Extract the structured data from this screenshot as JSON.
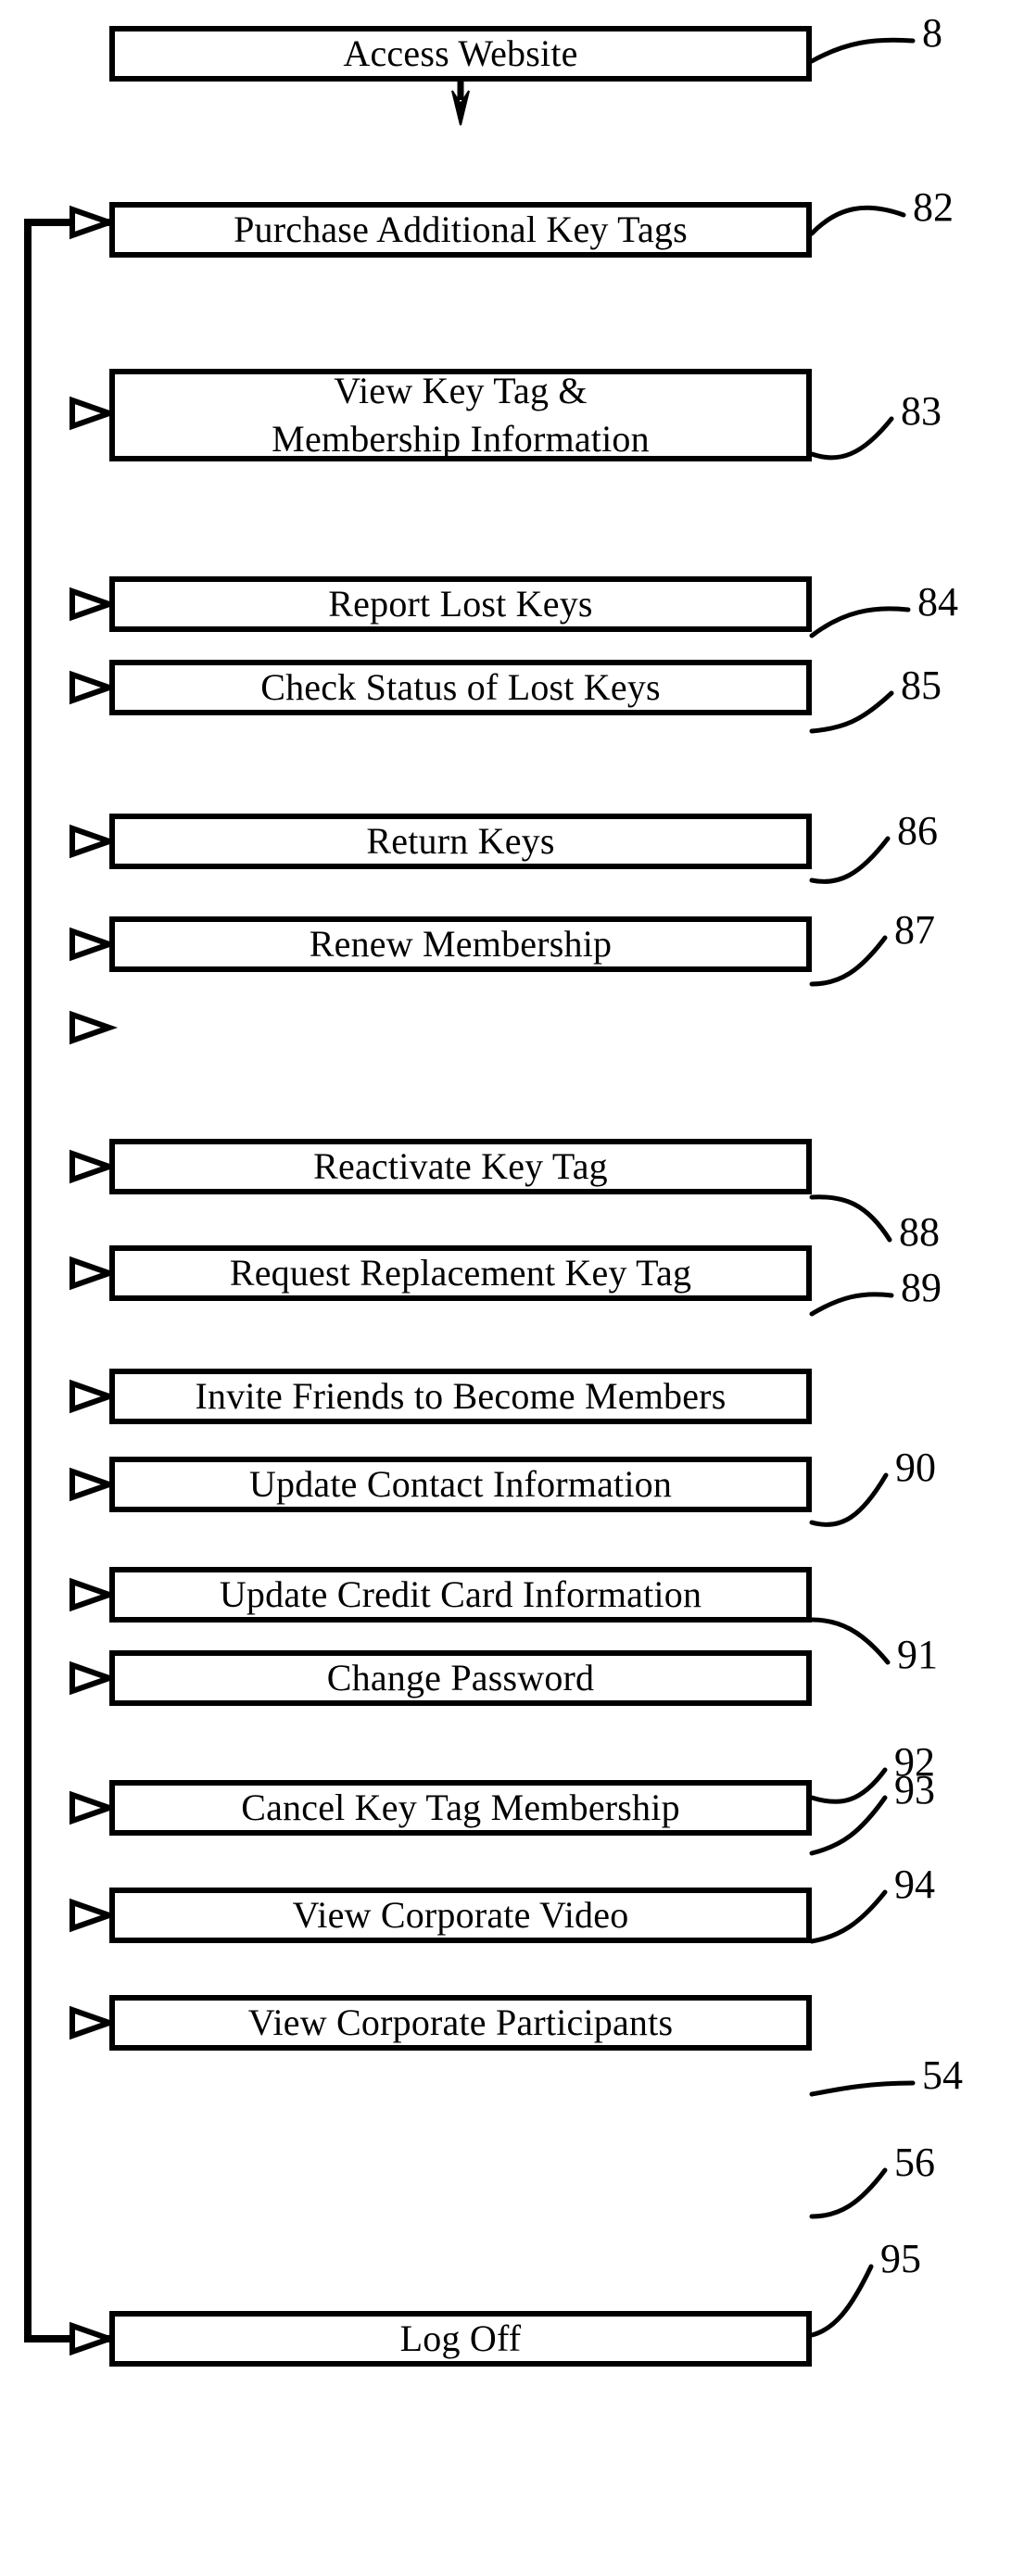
{
  "figure": {
    "type": "patent-flowchart",
    "background_color": "#ffffff",
    "line_color": "#000000",
    "entry": {
      "label": "Access Website",
      "ref": "8"
    },
    "nodes": [
      {
        "label": "Purchase Additional Key Tags",
        "ref": "82"
      },
      {
        "label": "View Key Tag &",
        "label2": "Membership Information",
        "ref": "83"
      },
      {
        "label": "Report Lost Keys",
        "ref": "84"
      },
      {
        "label": "Check Status of Lost Keys",
        "ref": "85"
      },
      {
        "label": "Return Keys",
        "ref": "86"
      },
      {
        "label": "Renew Membership",
        "ref": "87"
      },
      {
        "label": "Reactivate Key Tag",
        "ref": "88"
      },
      {
        "label": "Request Replacement Key Tag",
        "ref": "89"
      },
      {
        "label": "Invite Friends to Become Members",
        "ref": "90"
      },
      {
        "label": "Update Contact Information",
        "ref": "91"
      },
      {
        "label": "Update Credit Card Information",
        "ref": "92"
      },
      {
        "label": "Change Password",
        "ref": "93"
      },
      {
        "label": "Cancel Key Tag Membership",
        "ref": "94"
      },
      {
        "label": "View Corporate Video",
        "ref": "54"
      },
      {
        "label": "View Corporate Participants",
        "ref": "56"
      },
      {
        "label": "Log Off",
        "ref": "95"
      }
    ]
  }
}
